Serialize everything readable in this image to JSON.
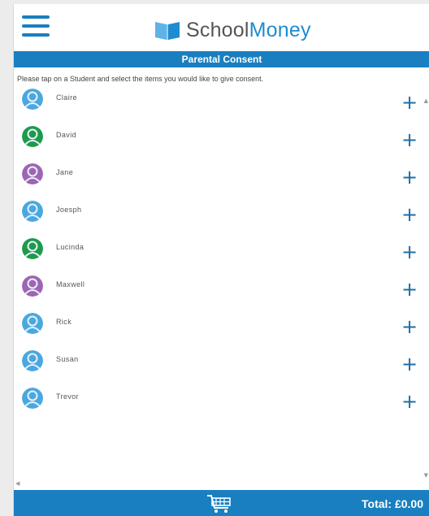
{
  "header": {
    "logo_text_part1": "School",
    "logo_text_part2": "Money",
    "menu_icon": "hamburger-icon",
    "logo_icon": "book-logo-icon"
  },
  "title_bar": {
    "title": "Parental Consent"
  },
  "instruction": "Please tap on a Student and select the items you would like to give consent.",
  "students": [
    {
      "name": "Claire",
      "avatar_color": "#4aa8e0",
      "add_label": "+"
    },
    {
      "name": "David",
      "avatar_color": "#1f9a4a",
      "add_label": "+"
    },
    {
      "name": "Jane",
      "avatar_color": "#a064b4",
      "add_label": "+"
    },
    {
      "name": "Joesph",
      "avatar_color": "#4aa8e0",
      "add_label": "+"
    },
    {
      "name": "Lucinda",
      "avatar_color": "#1f9a4a",
      "add_label": "+"
    },
    {
      "name": "Maxwell",
      "avatar_color": "#a064b4",
      "add_label": "+"
    },
    {
      "name": "Rick",
      "avatar_color": "#4aa8e0",
      "add_label": "+"
    },
    {
      "name": "Susan",
      "avatar_color": "#4aa8e0",
      "add_label": "+"
    },
    {
      "name": "Trevor",
      "avatar_color": "#4aa8e0",
      "add_label": "+"
    }
  ],
  "footer": {
    "cart_icon": "cart-icon",
    "total_label": "Total: £0.00"
  },
  "colors": {
    "brand_blue": "#1a7fc0",
    "plus_color": "#1d6fa8"
  }
}
